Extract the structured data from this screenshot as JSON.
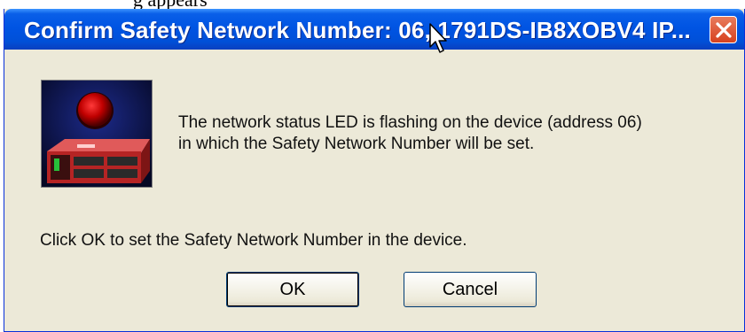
{
  "window": {
    "title": "Confirm Safety Network Number: 06, 1791DS-IB8XOBV4 IP..."
  },
  "message": {
    "line1": "The network status LED is flashing on the device (address 06)",
    "line2": "in which the Safety Network Number will be set."
  },
  "instruction": "Click OK to set the Safety Network Number in the device.",
  "buttons": {
    "ok": "OK",
    "cancel": "Cancel"
  },
  "colors": {
    "titlebar": "#0054e3",
    "dialog_bg": "#ece9d8",
    "close_button": "#d7411f",
    "led": "#d00000"
  },
  "icons": {
    "device_image": "flashing-led-device-icon",
    "close": "close-icon",
    "cursor": "mouse-pointer-icon"
  }
}
